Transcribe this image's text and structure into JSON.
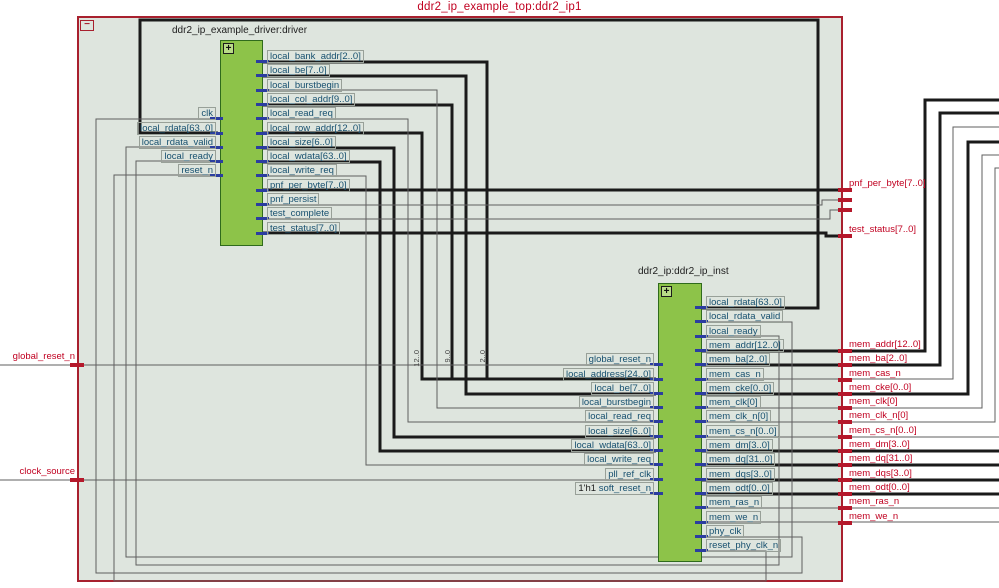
{
  "title": "ddr2_ip_example_top:ddr2_ip1",
  "icons": {
    "collapse": "−",
    "expand": "+"
  },
  "driver_block": {
    "label": "ddr2_ip_example_driver:driver",
    "left_ports": [
      {
        "label": "clk"
      },
      {
        "label": "local_rdata[63..0]"
      },
      {
        "label": "local_rdata_valid"
      },
      {
        "label": "local_ready"
      },
      {
        "label": "reset_n"
      }
    ],
    "right_ports": [
      {
        "label": "local_bank_addr[2..0]"
      },
      {
        "label": "local_be[7..0]"
      },
      {
        "label": "local_burstbegin"
      },
      {
        "label": "local_col_addr[9..0]"
      },
      {
        "label": "local_read_req"
      },
      {
        "label": "local_row_addr[12..0]"
      },
      {
        "label": "local_size[6..0]"
      },
      {
        "label": "local_wdata[63..0]"
      },
      {
        "label": "local_write_req"
      },
      {
        "label": "pnf_per_byte[7..0]"
      },
      {
        "label": "pnf_persist"
      },
      {
        "label": "test_complete"
      },
      {
        "label": "test_status[7..0]"
      }
    ]
  },
  "ip_block": {
    "label": "ddr2_ip:ddr2_ip_inst",
    "left_ports": [
      {
        "label": "global_reset_n"
      },
      {
        "label": "local_address[24..0]"
      },
      {
        "label": "local_be[7..0]"
      },
      {
        "label": "local_burstbegin"
      },
      {
        "label": "local_read_req"
      },
      {
        "label": "local_size[6..0]"
      },
      {
        "label": "local_wdata[63..0]"
      },
      {
        "label": "local_write_req"
      },
      {
        "label": "pll_ref_clk"
      },
      {
        "const": "1'h1",
        "label": "soft_reset_n"
      }
    ],
    "right_ports": [
      {
        "label": "local_rdata[63..0]"
      },
      {
        "label": "local_rdata_valid"
      },
      {
        "label": "local_ready"
      },
      {
        "label": "mem_addr[12..0]"
      },
      {
        "label": "mem_ba[2..0]"
      },
      {
        "label": "mem_cas_n"
      },
      {
        "label": "mem_cke[0..0]"
      },
      {
        "label": "mem_clk[0]"
      },
      {
        "label": "mem_clk_n[0]"
      },
      {
        "label": "mem_cs_n[0..0]"
      },
      {
        "label": "mem_dm[3..0]"
      },
      {
        "label": "mem_dq[31..0]"
      },
      {
        "label": "mem_dqs[3..0]"
      },
      {
        "label": "mem_odt[0..0]"
      },
      {
        "label": "mem_ras_n"
      },
      {
        "label": "mem_we_n"
      },
      {
        "label": "phy_clk"
      },
      {
        "label": "reset_phy_clk_n"
      }
    ]
  },
  "left_pins": [
    {
      "label": "global_reset_n"
    },
    {
      "label": "clock_source"
    }
  ],
  "top_right_pins": [
    {
      "label": "pnf_per_byte[7..0]"
    },
    {
      "label": "test_status[7..0]"
    }
  ],
  "mem_pins": [
    {
      "label": "mem_addr[12..0]"
    },
    {
      "label": "mem_ba[2..0]"
    },
    {
      "label": "mem_cas_n"
    },
    {
      "label": "mem_cke[0..0]"
    },
    {
      "label": "mem_clk[0]"
    },
    {
      "label": "mem_clk_n[0]"
    },
    {
      "label": "mem_cs_n[0..0]"
    },
    {
      "label": "mem_dm[3..0]"
    },
    {
      "label": "mem_dq[31..0]"
    },
    {
      "label": "mem_dqs[3..0]"
    },
    {
      "label": "mem_odt[0..0]"
    },
    {
      "label": "mem_ras_n"
    },
    {
      "label": "mem_we_n"
    }
  ],
  "bus_slice_labels": [
    "12..0",
    "9..0",
    "2..0"
  ],
  "colors": {
    "canvas_fill": "#dee5de",
    "border_red": "#a8202e",
    "pin_red": "#c00020",
    "port_blue": "#17506f",
    "block_green": "#8dc349",
    "stub_blue": "#2b3da0",
    "bus_black": "#1a1a1a",
    "net_gray": "#5f5f5f"
  }
}
